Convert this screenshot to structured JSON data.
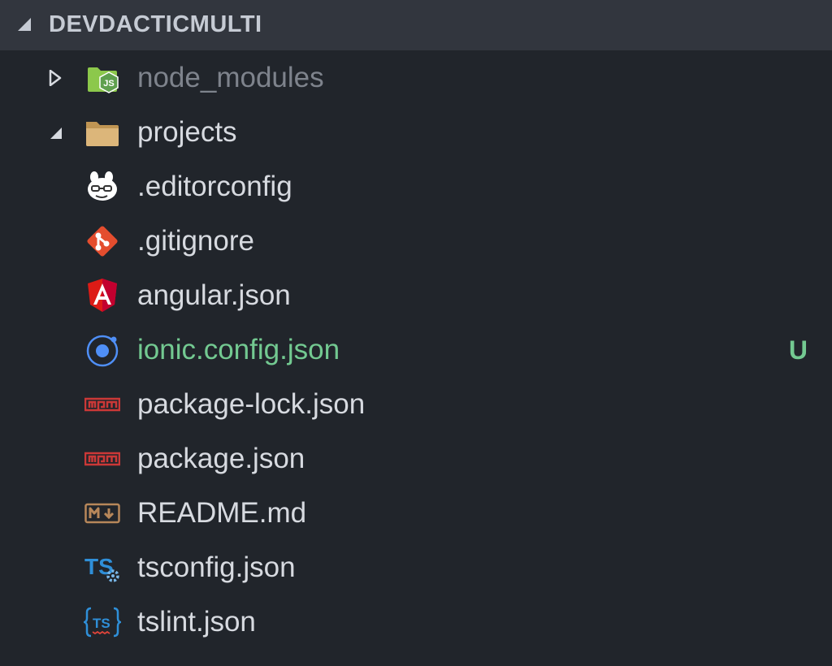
{
  "explorer": {
    "section_title": "DEVDACTICMULTI",
    "section_expanded": true,
    "items": [
      {
        "label": "node_modules",
        "type": "folder",
        "expanded": false,
        "icon": "nodejs-folder-icon",
        "dimmed": true
      },
      {
        "label": "projects",
        "type": "folder",
        "expanded": true,
        "icon": "folder-open-icon"
      },
      {
        "label": ".editorconfig",
        "type": "file",
        "icon": "editorconfig-icon"
      },
      {
        "label": ".gitignore",
        "type": "file",
        "icon": "git-icon"
      },
      {
        "label": "angular.json",
        "type": "file",
        "icon": "angular-icon"
      },
      {
        "label": "ionic.config.json",
        "type": "file",
        "icon": "ionic-icon",
        "git_status": "U"
      },
      {
        "label": "package-lock.json",
        "type": "file",
        "icon": "npm-icon"
      },
      {
        "label": "package.json",
        "type": "file",
        "icon": "npm-icon"
      },
      {
        "label": "README.md",
        "type": "file",
        "icon": "markdown-icon"
      },
      {
        "label": "tsconfig.json",
        "type": "file",
        "icon": "tsconfig-icon"
      },
      {
        "label": "tslint.json",
        "type": "file",
        "icon": "tslint-icon"
      }
    ]
  },
  "colors": {
    "background": "#21252b",
    "header_background": "#32363e",
    "text": "#d7dae0",
    "dimmed_text": "#7e838c",
    "untracked": "#73c991"
  }
}
